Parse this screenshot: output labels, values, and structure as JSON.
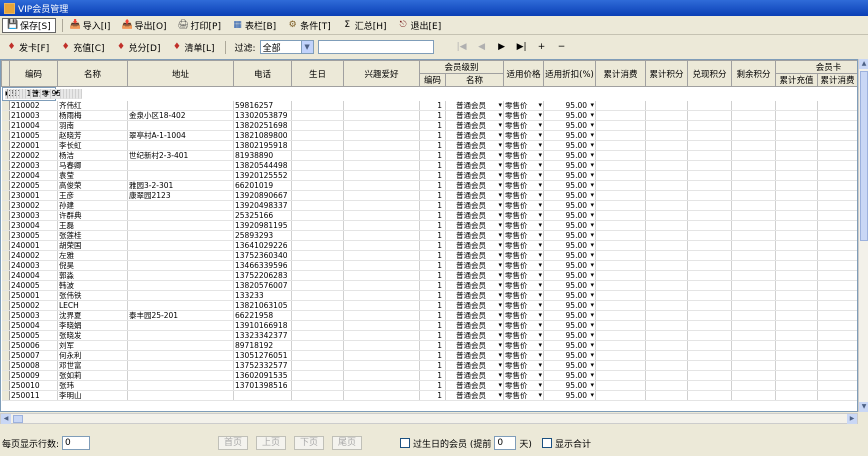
{
  "window": {
    "title": "VIP会员管理"
  },
  "toolbar": [
    {
      "label": "保存[S]",
      "icon": "save-icon"
    },
    {
      "label": "导入[I]",
      "icon": "import-icon"
    },
    {
      "label": "导出[O]",
      "icon": "export-icon"
    },
    {
      "label": "打印[P]",
      "icon": "print-icon"
    },
    {
      "label": "表栏[B]",
      "icon": "columns-icon"
    },
    {
      "label": "条件[T]",
      "icon": "filter-icon"
    },
    {
      "label": "汇总[H]",
      "icon": "sum-icon"
    },
    {
      "label": "退出[E]",
      "icon": "exit-icon"
    }
  ],
  "toolbar2": {
    "buttons": [
      {
        "label": "发卡[F]",
        "icon": "card-icon"
      },
      {
        "label": "充值[C]",
        "icon": "recharge-icon"
      },
      {
        "label": "兑分[D]",
        "icon": "exchange-icon"
      },
      {
        "label": "清单[L]",
        "icon": "list-icon"
      }
    ],
    "filter_label": "过滤:",
    "filter_value": "全部",
    "nav": [
      "|◀",
      "◀",
      "▶",
      "▶|",
      "+",
      "−"
    ]
  },
  "table": {
    "header_top": {
      "level": "会员级别",
      "card": "会员卡"
    },
    "headers": [
      "编码",
      "名称",
      "地址",
      "电话",
      "生日",
      "兴趣爱好",
      "编码",
      "名称",
      "适用价格",
      "适用折扣(%)",
      "累计消费",
      "累计积分",
      "兑现积分",
      "剩余积分",
      "累计充值",
      "累计消费",
      "当前"
    ],
    "level_code": "1",
    "level_name": "普通会员",
    "price": "零售价",
    "discount": "95.00",
    "rows": [
      [
        "210001",
        "郭海宾",
        "翠亭村B-13-401",
        "13502089269"
      ],
      [
        "210002",
        "齐伟红",
        "",
        "59816257"
      ],
      [
        "210003",
        "杨雨梅",
        "金泉小区18-402",
        "13302053879"
      ],
      [
        "210004",
        "羽南",
        "",
        "13820251698"
      ],
      [
        "210005",
        "赵晓芳",
        "翠亭村A-1-1004",
        "13821089800"
      ],
      [
        "220001",
        "李长虹",
        "",
        "13802195918"
      ],
      [
        "220002",
        "杨洁",
        "世纪新村2-3-401",
        "81938890"
      ],
      [
        "220003",
        "马春卿",
        "",
        "13820544498"
      ],
      [
        "220004",
        "袁莹",
        "",
        "13920125552"
      ],
      [
        "220005",
        "高俊荣",
        "雅园3-2-301",
        "66201019"
      ],
      [
        "230001",
        "王彦",
        "康翠园2123",
        "13920890667"
      ],
      [
        "230002",
        "孙建",
        "",
        "13920498337"
      ],
      [
        "230003",
        "许群典",
        "",
        "25325166"
      ],
      [
        "230004",
        "王磊",
        "",
        "13920981195"
      ],
      [
        "230005",
        "张莲桂",
        "",
        "25893293"
      ],
      [
        "240001",
        "胡荣国",
        "",
        "13641029226"
      ],
      [
        "240002",
        "左雅",
        "",
        "13752360340"
      ],
      [
        "240003",
        "倪昊",
        "",
        "13466339596"
      ],
      [
        "240004",
        "郭淼",
        "",
        "13752206283"
      ],
      [
        "240005",
        "韩波",
        "",
        "13820576007"
      ],
      [
        "250001",
        "张伟铁",
        "",
        "133233"
      ],
      [
        "250002",
        "LECH",
        "",
        "13821063105"
      ],
      [
        "250003",
        "沈界夏",
        "泰丰园25-201",
        "66221958"
      ],
      [
        "250004",
        "李晓娟",
        "",
        "13910166918"
      ],
      [
        "250005",
        "张晓发",
        "",
        "13323342377"
      ],
      [
        "250006",
        "刘军",
        "",
        "89718192"
      ],
      [
        "250007",
        "何永利",
        "",
        "13051276051"
      ],
      [
        "250008",
        "邓世富",
        "",
        "13752332577"
      ],
      [
        "250009",
        "张如莉",
        "",
        "13602091535"
      ],
      [
        "250010",
        "张玮",
        "",
        "13701398516"
      ],
      [
        "250011",
        "李明山",
        "",
        ""
      ]
    ]
  },
  "footer": {
    "rows_label": "每页显示行数:",
    "rows_value": "0",
    "pages": [
      "首页",
      "上页",
      "下页",
      "尾页"
    ],
    "bday_label": "过生日的会员 (提前",
    "bday_value": "0",
    "bday_unit": "天)",
    "sum_label": "显示合计"
  }
}
